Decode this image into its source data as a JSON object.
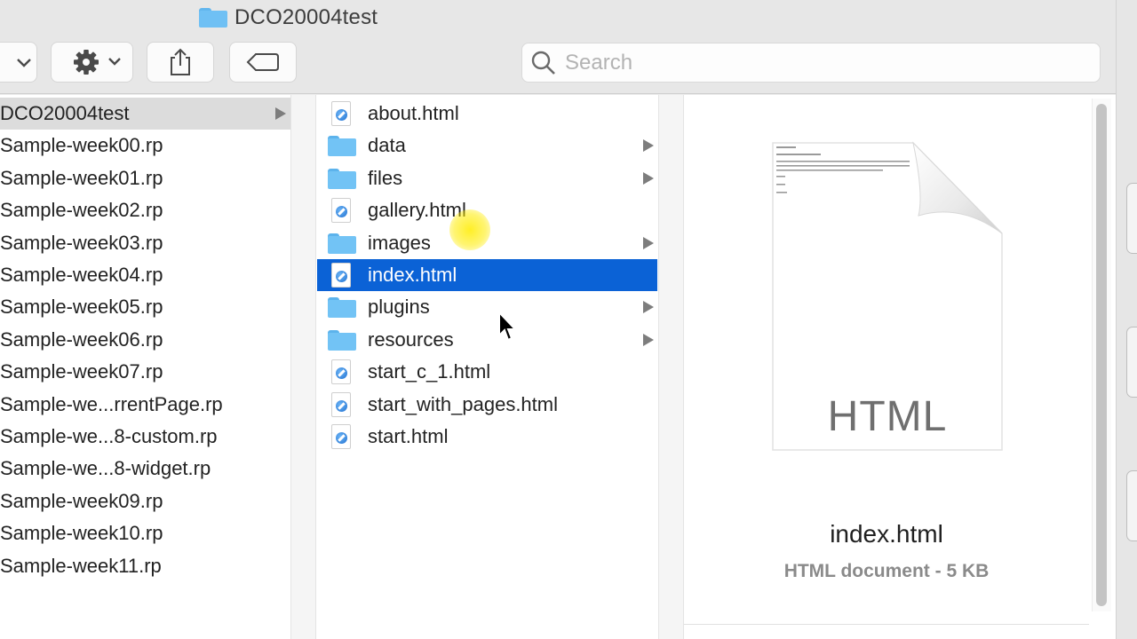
{
  "window": {
    "title": "DCO20004test"
  },
  "toolbar": {
    "search_placeholder": "Search"
  },
  "column1": {
    "items": [
      {
        "label": "DCO20004test",
        "has_children": true,
        "selected": true
      },
      {
        "label": "Sample-week00.rp"
      },
      {
        "label": "Sample-week01.rp"
      },
      {
        "label": "Sample-week02.rp"
      },
      {
        "label": "Sample-week03.rp"
      },
      {
        "label": "Sample-week04.rp"
      },
      {
        "label": "Sample-week05.rp"
      },
      {
        "label": "Sample-week06.rp"
      },
      {
        "label": "Sample-week07.rp"
      },
      {
        "label": "Sample-we...rrentPage.rp"
      },
      {
        "label": "Sample-we...8-custom.rp"
      },
      {
        "label": "Sample-we...8-widget.rp"
      },
      {
        "label": "Sample-week09.rp"
      },
      {
        "label": "Sample-week10.rp"
      },
      {
        "label": "Sample-week11.rp"
      }
    ]
  },
  "column2": {
    "items": [
      {
        "label": "about.html",
        "type": "html-file-icon"
      },
      {
        "label": "data",
        "type": "folder-icon",
        "has_children": true
      },
      {
        "label": "files",
        "type": "folder-icon",
        "has_children": true
      },
      {
        "label": "gallery.html",
        "type": "html-file-icon"
      },
      {
        "label": "images",
        "type": "folder-icon",
        "has_children": true
      },
      {
        "label": "index.html",
        "type": "html-file-icon",
        "selected": true
      },
      {
        "label": "plugins",
        "type": "folder-icon",
        "has_children": true
      },
      {
        "label": "resources",
        "type": "folder-icon",
        "has_children": true
      },
      {
        "label": "start_c_1.html",
        "type": "html-file-icon"
      },
      {
        "label": "start_with_pages.html",
        "type": "html-file-icon"
      },
      {
        "label": "start.html",
        "type": "html-file-icon"
      }
    ]
  },
  "preview": {
    "thumbnail_label": "HTML",
    "file_name": "index.html",
    "file_kind": "HTML document - 5 KB"
  },
  "colors": {
    "selection_blue": "#0b62d6",
    "folder_blue": "#72c3f5",
    "inactive_selection": "#dcdcdc"
  }
}
